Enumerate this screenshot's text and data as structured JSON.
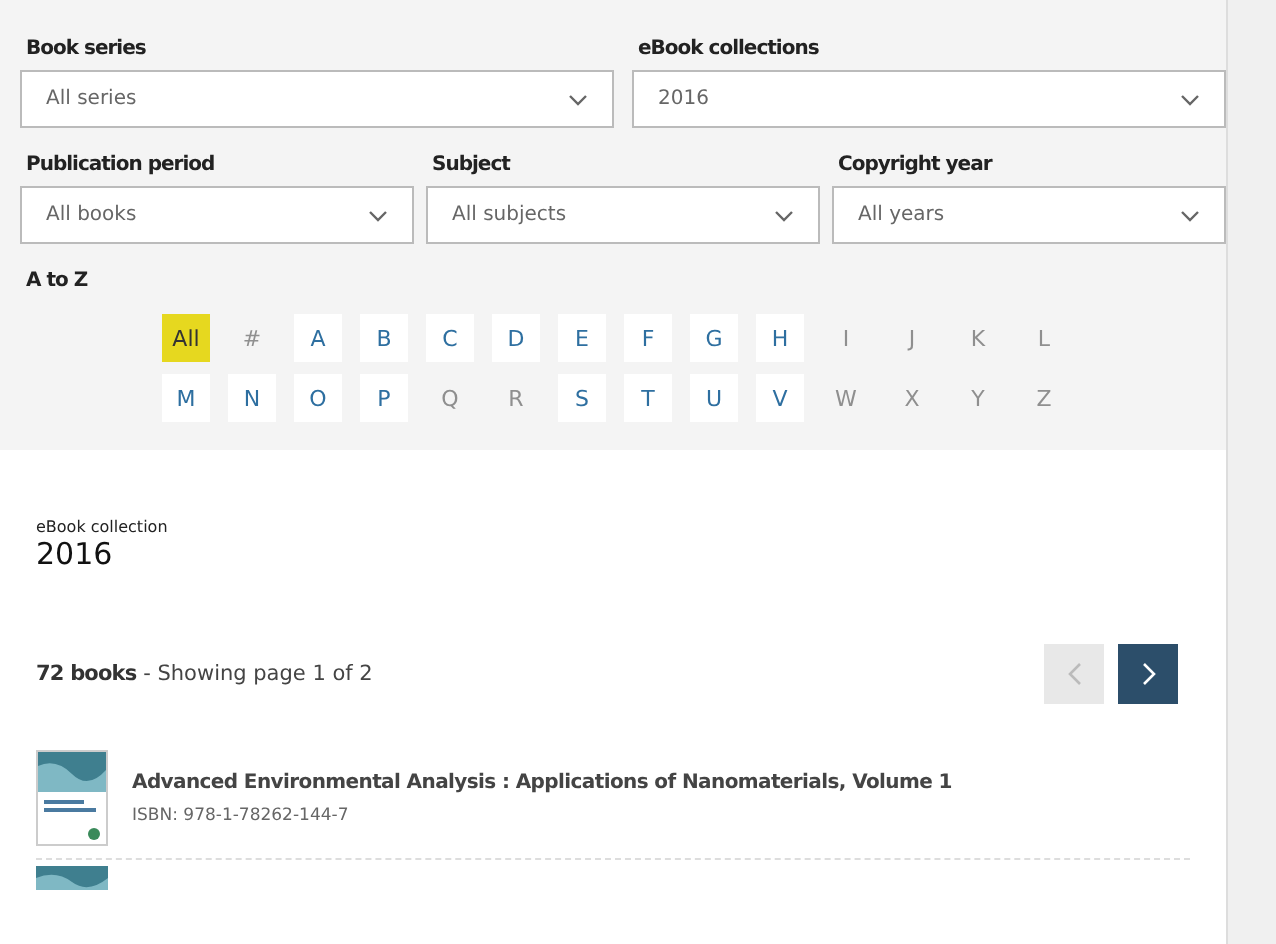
{
  "filters": {
    "row_1": [
      {
        "label": "Book series",
        "value": "All series"
      },
      {
        "label": "eBook collections",
        "value": "2016"
      }
    ],
    "row_2": [
      {
        "label": "Publication period",
        "value": "All books"
      },
      {
        "label": "Subject",
        "value": "All subjects"
      },
      {
        "label": "Copyright year",
        "value": "All years"
      }
    ]
  },
  "a_to_z": {
    "label": "A to Z",
    "letters": [
      {
        "text": "All",
        "selected": true,
        "disabled": false
      },
      {
        "text": "#",
        "selected": false,
        "disabled": true
      },
      {
        "text": "A",
        "selected": false,
        "disabled": false
      },
      {
        "text": "B",
        "selected": false,
        "disabled": false
      },
      {
        "text": "C",
        "selected": false,
        "disabled": false
      },
      {
        "text": "D",
        "selected": false,
        "disabled": false
      },
      {
        "text": "E",
        "selected": false,
        "disabled": false
      },
      {
        "text": "F",
        "selected": false,
        "disabled": false
      },
      {
        "text": "G",
        "selected": false,
        "disabled": false
      },
      {
        "text": "H",
        "selected": false,
        "disabled": false
      },
      {
        "text": "I",
        "selected": false,
        "disabled": true
      },
      {
        "text": "J",
        "selected": false,
        "disabled": true
      },
      {
        "text": "K",
        "selected": false,
        "disabled": true
      },
      {
        "text": "L",
        "selected": false,
        "disabled": true
      },
      {
        "text": "M",
        "selected": false,
        "disabled": false
      },
      {
        "text": "N",
        "selected": false,
        "disabled": false
      },
      {
        "text": "O",
        "selected": false,
        "disabled": false
      },
      {
        "text": "P",
        "selected": false,
        "disabled": false
      },
      {
        "text": "Q",
        "selected": false,
        "disabled": true
      },
      {
        "text": "R",
        "selected": false,
        "disabled": true
      },
      {
        "text": "S",
        "selected": false,
        "disabled": false
      },
      {
        "text": "T",
        "selected": false,
        "disabled": false
      },
      {
        "text": "U",
        "selected": false,
        "disabled": false
      },
      {
        "text": "V",
        "selected": false,
        "disabled": false
      },
      {
        "text": "W",
        "selected": false,
        "disabled": true
      },
      {
        "text": "X",
        "selected": false,
        "disabled": true
      },
      {
        "text": "Y",
        "selected": false,
        "disabled": true
      },
      {
        "text": "Z",
        "selected": false,
        "disabled": true
      }
    ]
  },
  "collection": {
    "caption": "eBook collection",
    "title": "2016"
  },
  "results": {
    "count": "72 books",
    "separator": "-",
    "page_info": "Showing page 1 of 2",
    "prev_disabled": true,
    "next_disabled": false
  },
  "books": [
    {
      "title": "Advanced Environmental Analysis : Applications of Nanomaterials, Volume 1",
      "isbn": "ISBN: 978-1-78262-144-7"
    }
  ]
}
